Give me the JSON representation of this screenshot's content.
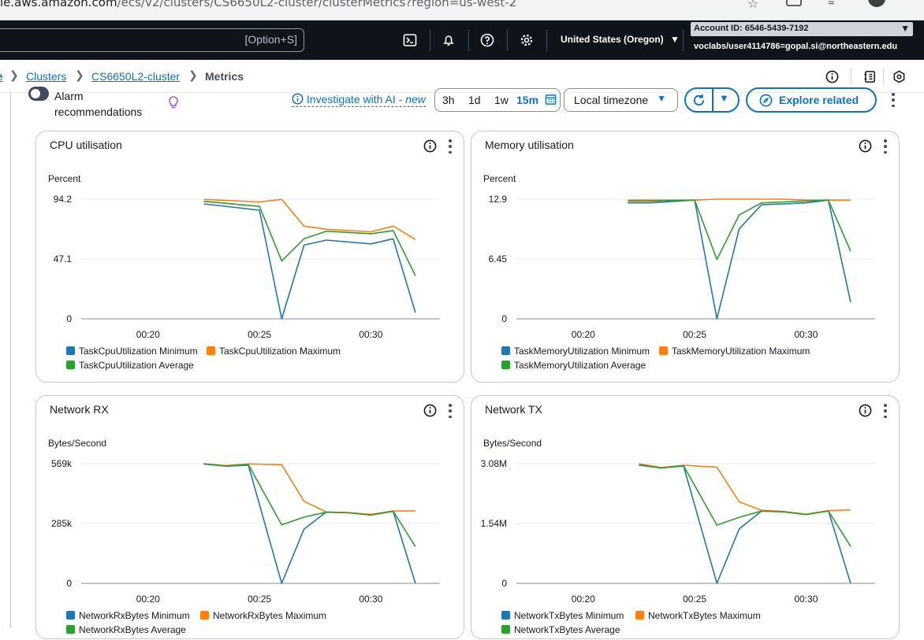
{
  "browser": {
    "url_host": "le.aws.amazon.com",
    "url_path": "/ecs/v2/clusters/CS6650L2-cluster/clusterMetrics?region=us-west-2"
  },
  "topnav": {
    "search_shortcut": "[Option+S]",
    "region": "United States (Oregon)",
    "account_id": "Account ID: 6546-5439-7192",
    "user": "voclabs/user4114786=gopal.si@northeastern.edu"
  },
  "breadcrumb": {
    "items": [
      {
        "label": "Clusters"
      },
      {
        "label": "CS6650L2-cluster"
      },
      {
        "label": "Metrics"
      }
    ]
  },
  "controls": {
    "alarm_label_line1": "Alarm",
    "alarm_label_line2": "recommendations",
    "investigate": "Investigate with AI - ",
    "investigate_new": "new",
    "ranges": [
      "3h",
      "1d",
      "1w",
      "15m"
    ],
    "active_range": "15m",
    "timezone": "Local timezone",
    "explore": "Explore related",
    "colors": {
      "accent": "#0972d3"
    }
  },
  "chart_data": [
    {
      "type": "line",
      "title": "CPU utilisation",
      "ylabel": "Percent",
      "ytick_labels": [
        "94.2",
        "47.1",
        "0"
      ],
      "ylim": [
        0,
        94.2
      ],
      "xtick_labels": [
        "00:20",
        "00:25",
        "00:30"
      ],
      "xlim": [
        17,
        33.1
      ],
      "x": [
        22.5,
        25,
        26,
        27,
        28,
        30,
        31,
        32
      ],
      "series": [
        {
          "name": "TaskCpuUtilization Minimum",
          "color": "#1f77b4",
          "values": [
            90.5,
            85.5,
            0,
            58,
            62,
            59,
            63,
            5
          ]
        },
        {
          "name": "TaskCpuUtilization Maximum",
          "color": "#ff7f0e",
          "values": [
            94,
            92,
            94,
            73,
            70.5,
            68.5,
            73,
            62.5
          ]
        },
        {
          "name": "TaskCpuUtilization Average",
          "color": "#2ca02c",
          "values": [
            92.5,
            88.5,
            45.5,
            63,
            69,
            67,
            69.5,
            34
          ]
        }
      ]
    },
    {
      "type": "line",
      "title": "Memory utilisation",
      "ylabel": "Percent",
      "ytick_labels": [
        "12.9",
        "6.45",
        "0"
      ],
      "ylim": [
        0,
        12.9
      ],
      "xtick_labels": [
        "00:20",
        "00:25",
        "00:30"
      ],
      "xlim": [
        17,
        33.1
      ],
      "x": [
        22,
        23,
        25,
        26,
        27,
        28,
        29,
        30,
        31,
        32
      ],
      "series": [
        {
          "name": "TaskMemoryUtilization Minimum",
          "color": "#1f77b4",
          "values": [
            12.5,
            12.5,
            12.8,
            0,
            9.7,
            12.3,
            12.4,
            12.5,
            12.8,
            1.8
          ]
        },
        {
          "name": "TaskMemoryUtilization Maximum",
          "color": "#ff7f0e",
          "values": [
            12.8,
            12.8,
            12.8,
            12.9,
            12.9,
            12.9,
            12.9,
            12.8,
            12.8,
            12.8
          ]
        },
        {
          "name": "TaskMemoryUtilization Average",
          "color": "#2ca02c",
          "values": [
            12.7,
            12.7,
            12.8,
            6.4,
            11.2,
            12.5,
            12.6,
            12.7,
            12.8,
            7.3
          ]
        }
      ]
    },
    {
      "type": "line",
      "title": "Network RX",
      "ylabel": "Bytes/Second",
      "ytick_labels": [
        "569k",
        "285k",
        "0"
      ],
      "ylim": [
        0,
        569
      ],
      "xtick_labels": [
        "00:20",
        "00:25",
        "00:30"
      ],
      "xlim": [
        17,
        33.1
      ],
      "x": [
        22.5,
        23.5,
        24.5,
        26,
        27,
        28,
        29,
        30,
        31,
        32
      ],
      "series": [
        {
          "name": "NetworkRxBytes Minimum",
          "color": "#1f77b4",
          "values": [
            567,
            557,
            562,
            0,
            258,
            339,
            336,
            325,
            342,
            0
          ]
        },
        {
          "name": "NetworkRxBytes Maximum",
          "color": "#ff7f0e",
          "values": [
            569,
            560,
            568,
            564,
            390,
            339,
            336,
            328,
            344,
            344
          ]
        },
        {
          "name": "NetworkRxBytes Average",
          "color": "#2ca02c",
          "values": [
            568,
            558,
            565,
            278,
            315,
            338,
            335,
            325,
            343,
            175
          ]
        }
      ]
    },
    {
      "type": "line",
      "title": "Network TX",
      "ylabel": "Bytes/Second",
      "ytick_labels": [
        "3.08M",
        "1.54M",
        "0"
      ],
      "ylim": [
        0,
        3.08
      ],
      "xtick_labels": [
        "00:20",
        "00:25",
        "00:30"
      ],
      "xlim": [
        17,
        33.1
      ],
      "x": [
        22.5,
        23.5,
        24.5,
        26,
        27,
        28,
        29,
        30,
        31,
        32
      ],
      "series": [
        {
          "name": "NetworkTxBytes Minimum",
          "color": "#1f77b4",
          "values": [
            3.04,
            2.97,
            3.02,
            0,
            1.4,
            1.86,
            1.84,
            1.77,
            1.87,
            0
          ]
        },
        {
          "name": "NetworkTxBytes Maximum",
          "color": "#ff7f0e",
          "values": [
            3.08,
            2.98,
            3.04,
            2.99,
            2.1,
            1.88,
            1.85,
            1.78,
            1.87,
            1.89
          ]
        },
        {
          "name": "NetworkTxBytes Average",
          "color": "#2ca02c",
          "values": [
            3.05,
            2.97,
            3.03,
            1.5,
            1.7,
            1.86,
            1.84,
            1.77,
            1.86,
            0.95
          ]
        }
      ]
    }
  ]
}
